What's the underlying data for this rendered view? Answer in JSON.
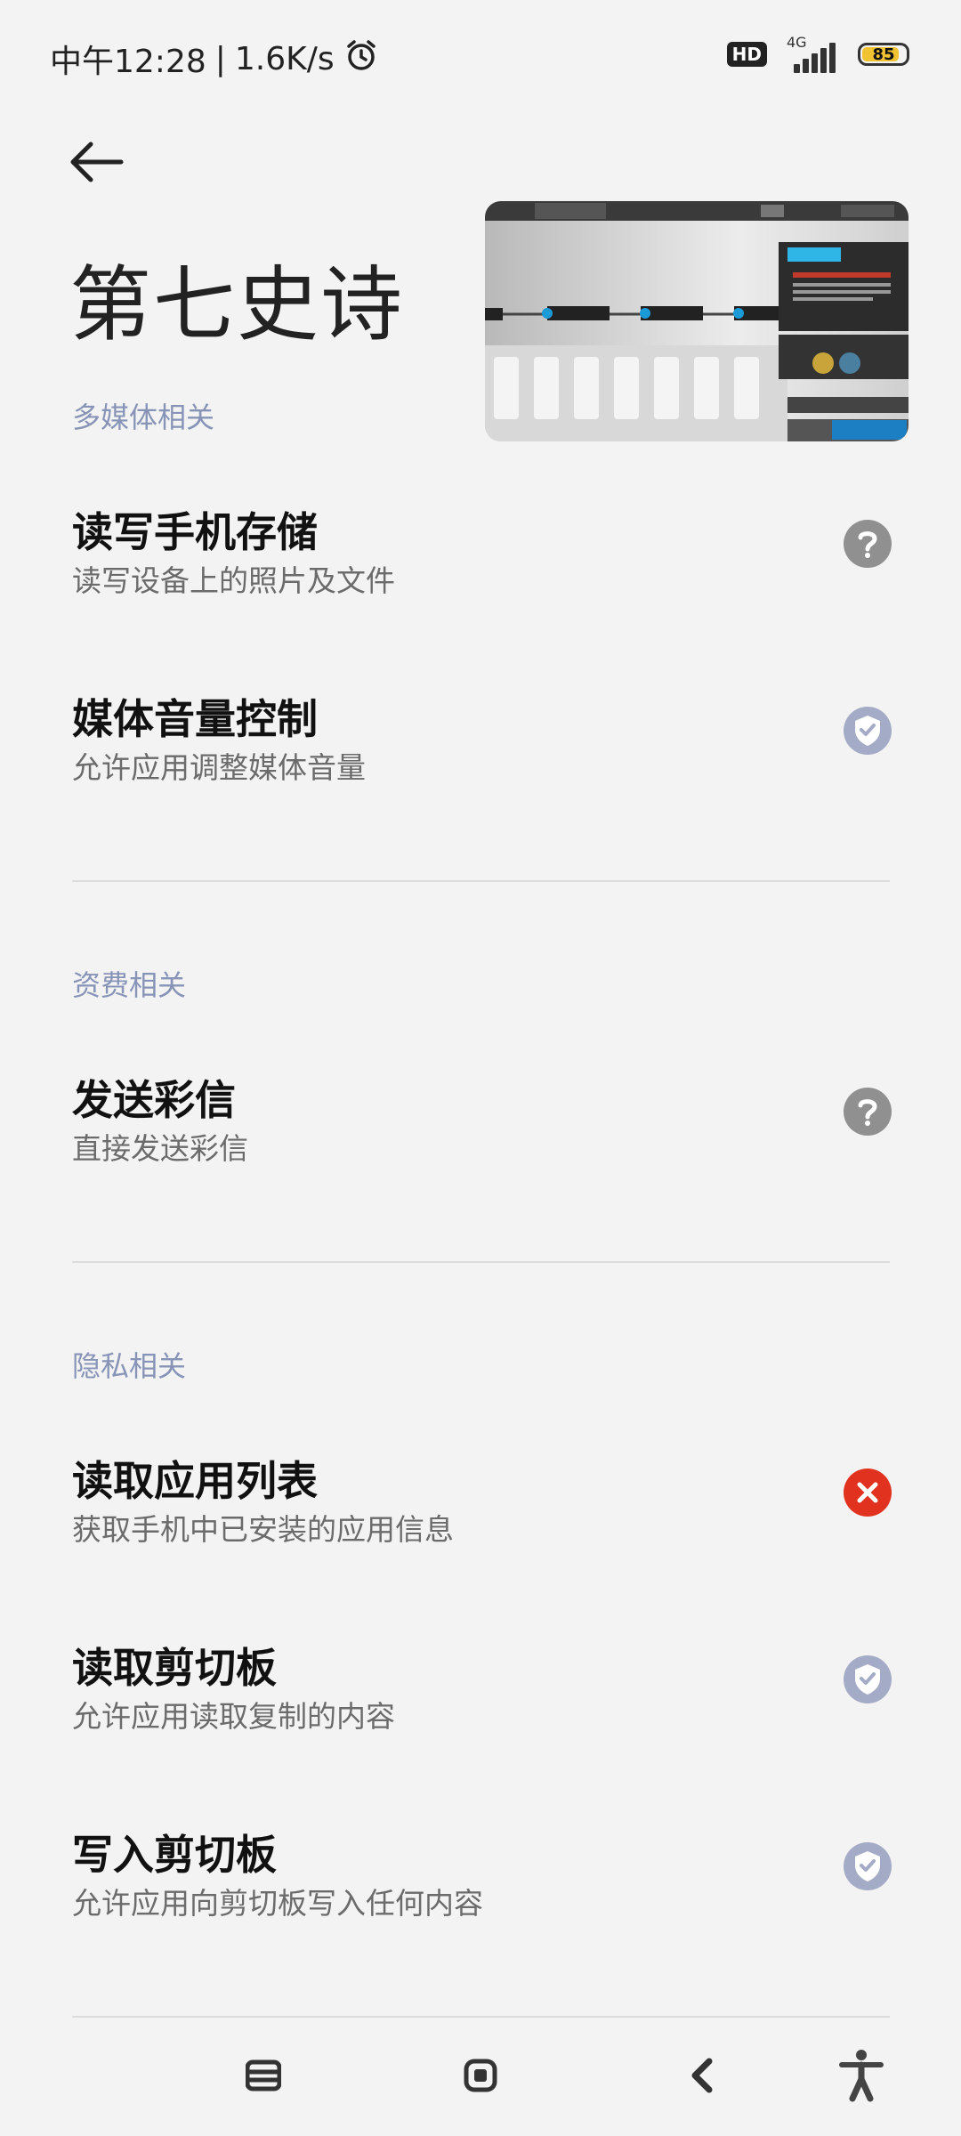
{
  "status_bar": {
    "time": "中午12:28",
    "separator": "|",
    "net_speed": "1.6K/s",
    "alarm_icon": "alarm-clock-icon",
    "hd_badge": "HD",
    "network_type": "4G",
    "battery": "85",
    "battery_level": 0.85
  },
  "header": {
    "back_icon": "arrow-left-icon",
    "title": "第七史诗"
  },
  "sections": [
    {
      "title": "多媒体相关",
      "items": [
        {
          "title": "读写手机存储",
          "subtitle": "读写设备上的照片及文件",
          "status": "ask",
          "icon": "question-circle-icon"
        },
        {
          "title": "媒体音量控制",
          "subtitle": "允许应用调整媒体音量",
          "status": "allowed",
          "icon": "check-shield-icon"
        }
      ]
    },
    {
      "title": "资费相关",
      "items": [
        {
          "title": "发送彩信",
          "subtitle": "直接发送彩信",
          "status": "ask",
          "icon": "question-circle-icon"
        }
      ]
    },
    {
      "title": "隐私相关",
      "items": [
        {
          "title": "读取应用列表",
          "subtitle": "获取手机中已安装的应用信息",
          "status": "denied",
          "icon": "close-circle-icon"
        },
        {
          "title": "读取剪切板",
          "subtitle": "允许应用读取复制的内容",
          "status": "allowed",
          "icon": "check-shield-icon"
        },
        {
          "title": "写入剪切板",
          "subtitle": "允许应用向剪切板写入任何内容",
          "status": "allowed",
          "icon": "check-shield-icon"
        }
      ]
    }
  ],
  "colors": {
    "section_title": "#8794b7",
    "ask": "#909090",
    "allowed": "#a4abc6",
    "denied": "#e0321f"
  },
  "nav_bar": {
    "icons": [
      "menu-icon",
      "home-icon",
      "back-icon",
      "accessibility-icon"
    ]
  }
}
